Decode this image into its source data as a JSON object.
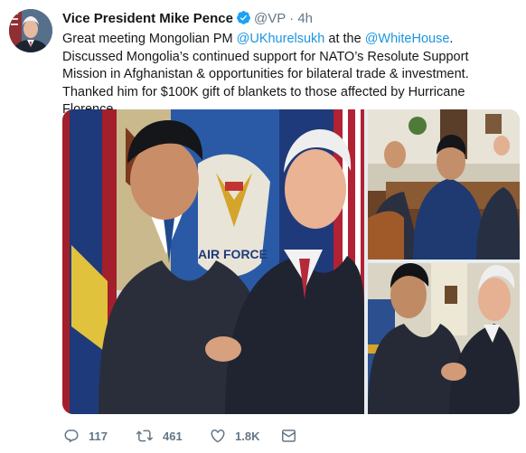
{
  "tweet": {
    "author_name": "Vice President Mike Pence",
    "handle": "@VP",
    "separator": "·",
    "time": "4h",
    "text_parts": [
      {
        "t": "Great meeting Mongolian PM ",
        "link": false
      },
      {
        "t": "@UKhurelsukh",
        "link": true
      },
      {
        "t": " at the ",
        "link": false
      },
      {
        "t": "@WhiteHouse",
        "link": true
      },
      {
        "t": ". Discussed Mongolia’s continued support for NATO’s Resolute Support Mission in Afghanistan & opportunities for bilateral trade & investment. Thanked him for $100K gift of blankets to those affected by Hurricane Florence.",
        "link": false
      }
    ],
    "actions": {
      "replies": "117",
      "retweets": "461",
      "likes": "1.8K"
    },
    "icons": {
      "verified": "verified-badge-icon",
      "reply": "reply-icon",
      "retweet": "retweet-icon",
      "like": "heart-icon",
      "dm": "envelope-icon"
    },
    "colors": {
      "link": "#1b95e0",
      "verified": "#1da1f2",
      "secondary_text": "#657786"
    }
  }
}
